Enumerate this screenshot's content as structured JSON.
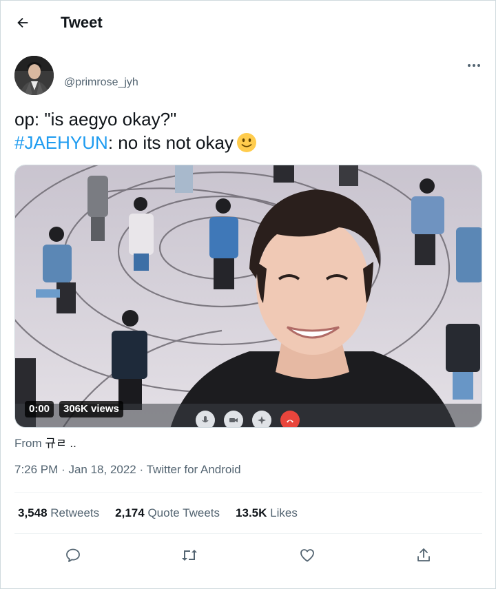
{
  "header": {
    "title": "Tweet"
  },
  "author": {
    "handle": "@primrose_jyh"
  },
  "tweet": {
    "line1": "op: \"is aegyo okay?\"",
    "hashtag": "#JAEHYUN",
    "line2_rest": ": no its not okay"
  },
  "media": {
    "time": "0:00",
    "views": "306K views"
  },
  "source": {
    "prefix": "From",
    "name": "규ㄹ .."
  },
  "meta": {
    "time": "7:26 PM",
    "date": "Jan 18, 2022",
    "client": "Twitter for Android",
    "sep": "·"
  },
  "stats": [
    {
      "count": "3,548",
      "label": "Retweets"
    },
    {
      "count": "2,174",
      "label": "Quote Tweets"
    },
    {
      "count": "13.5K",
      "label": "Likes"
    }
  ],
  "colors": {
    "accent": "#1d9bf0",
    "muted": "#536471",
    "text": "#0f1419",
    "end_call": "#e8453c"
  }
}
